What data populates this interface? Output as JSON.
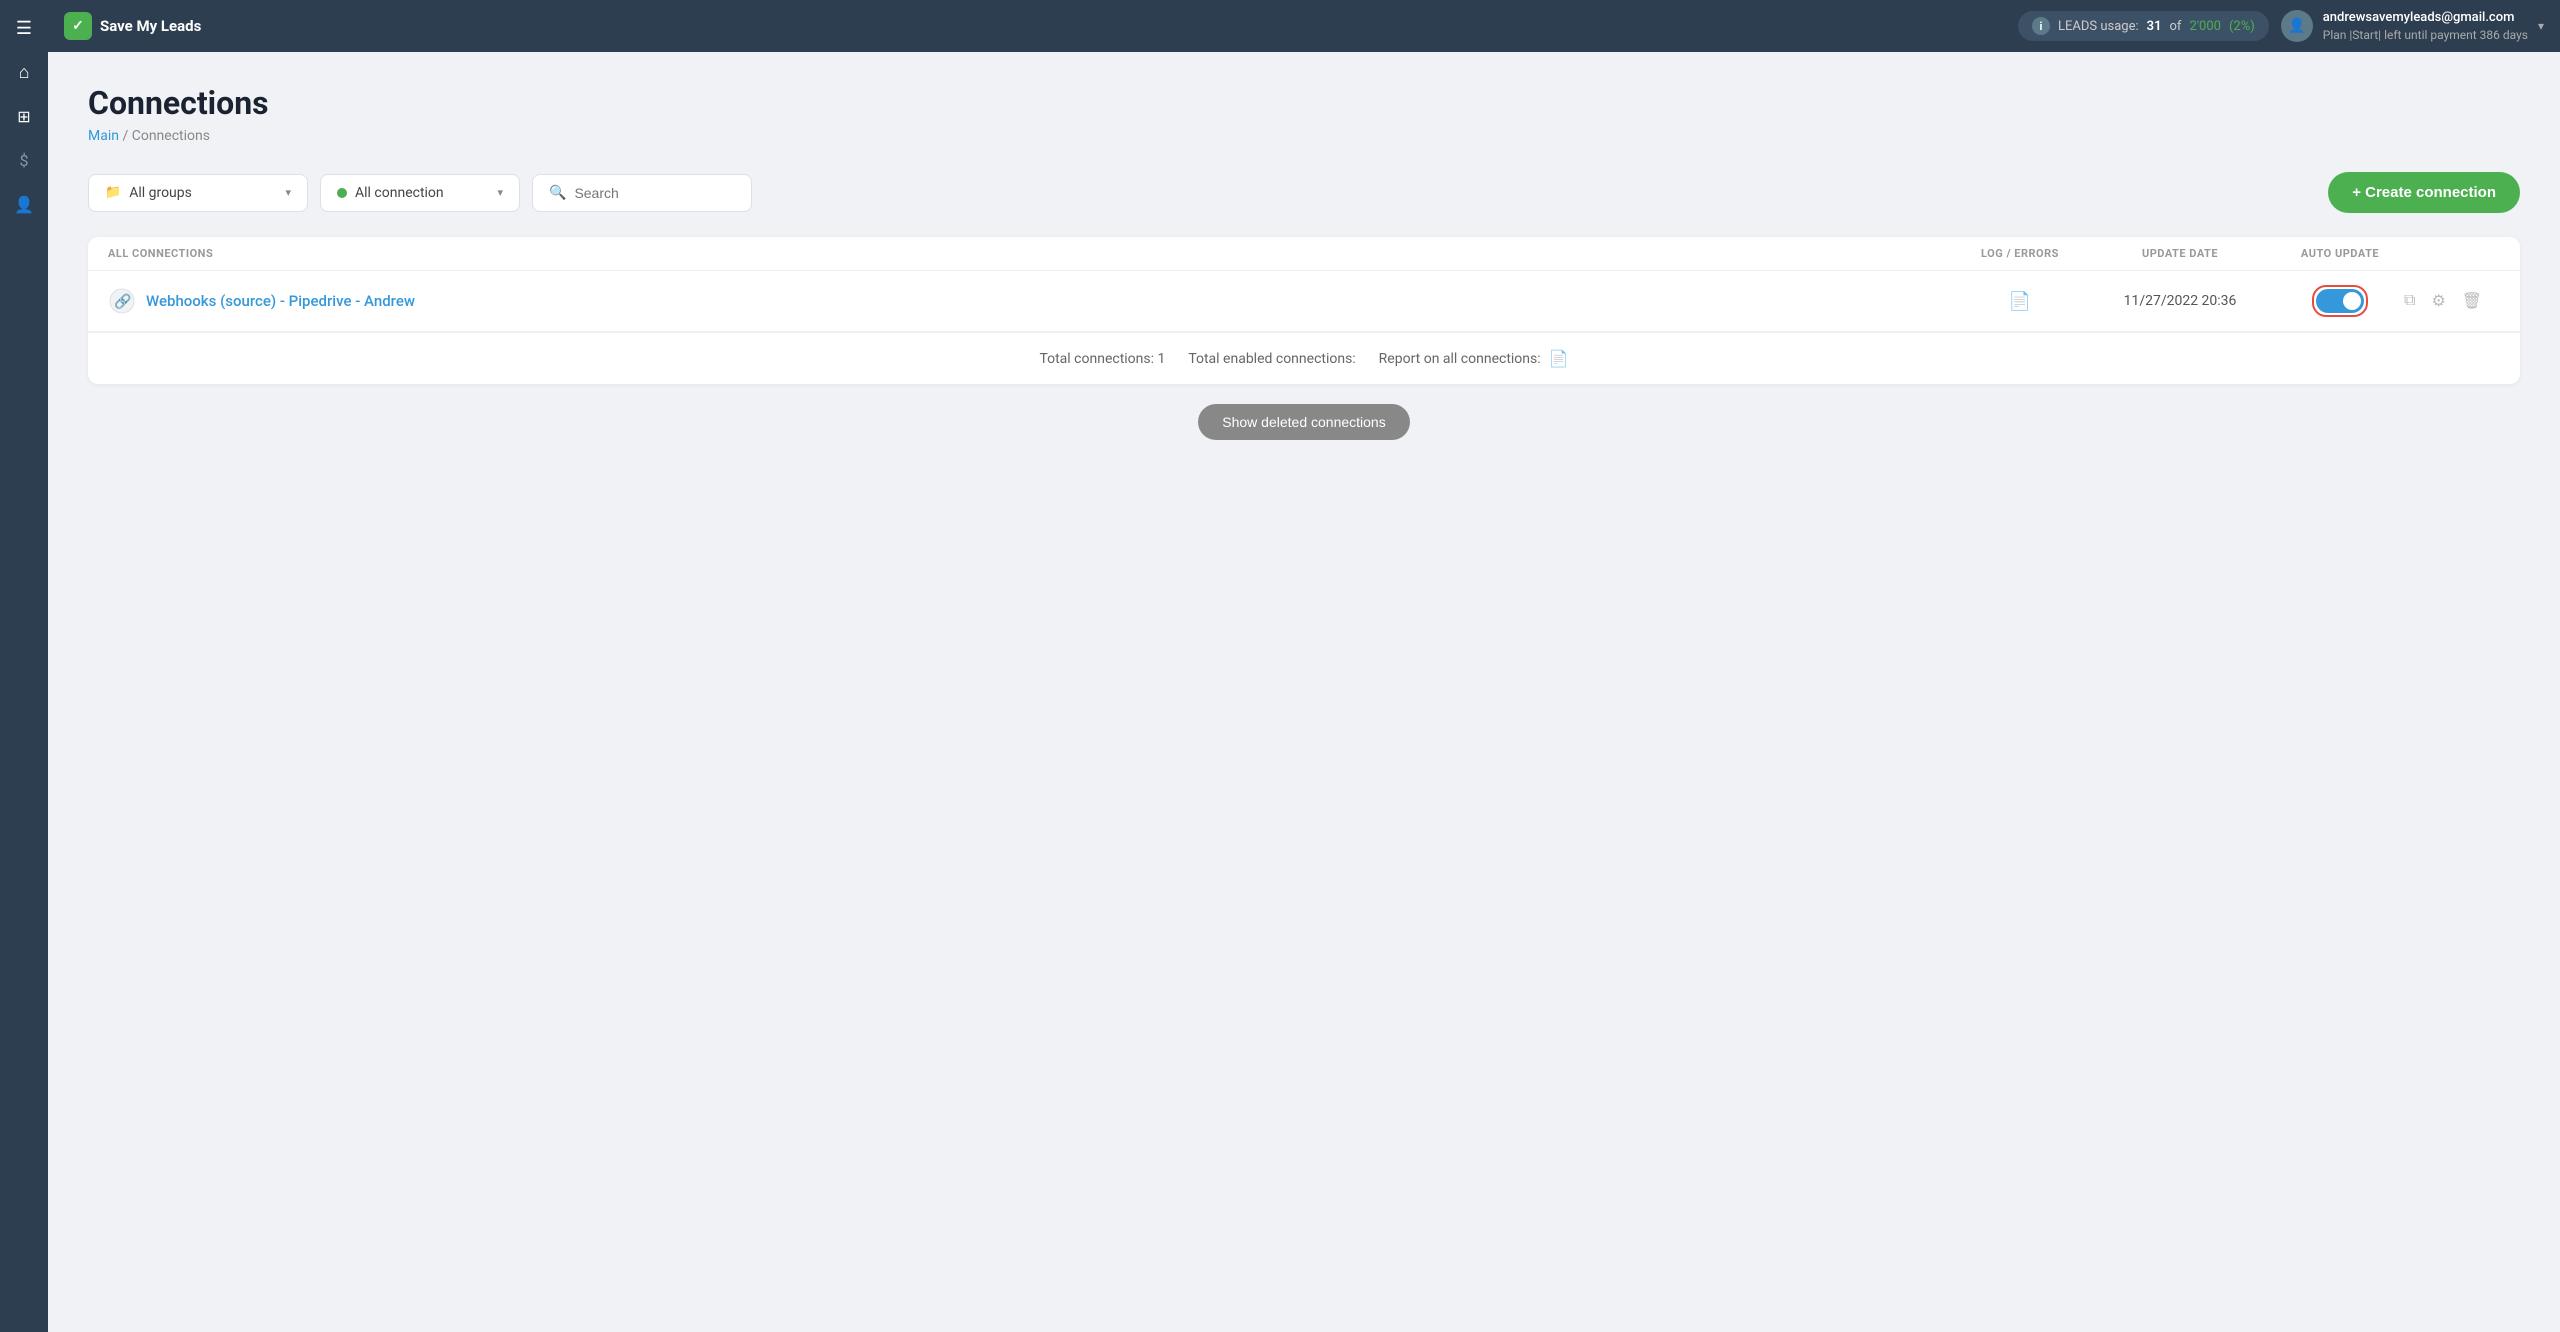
{
  "app": {
    "name": "Save My Leads",
    "logo_text": "✓"
  },
  "topnav": {
    "leads_usage_label": "LEADS usage:",
    "leads_current": "31",
    "leads_total": "2'000",
    "leads_percent": "(2%)",
    "user_email": "andrewsavemyleads@gmail.com",
    "user_plan": "Plan |Start| left until payment 386 days",
    "info_icon": "i"
  },
  "sidebar": {
    "items": [
      {
        "icon": "☰",
        "name": "menu"
      },
      {
        "icon": "⌂",
        "name": "home"
      },
      {
        "icon": "⊞",
        "name": "integrations"
      },
      {
        "icon": "$",
        "name": "billing"
      },
      {
        "icon": "👤",
        "name": "profile"
      }
    ]
  },
  "page": {
    "title": "Connections",
    "breadcrumb_main": "Main",
    "breadcrumb_separator": " / ",
    "breadcrumb_current": "Connections"
  },
  "filters": {
    "groups_label": "All groups",
    "connection_label": "All connection",
    "search_placeholder": "Search",
    "create_button": "+ Create connection"
  },
  "table": {
    "columns": {
      "all_connections": "ALL CONNECTIONS",
      "log_errors": "LOG / ERRORS",
      "update_date": "UPDATE DATE",
      "auto_update": "AUTO UPDATE"
    },
    "rows": [
      {
        "name": "Webhooks (source) - Pipedrive - Andrew",
        "update_date": "11/27/2022 20:36",
        "auto_update": true
      }
    ]
  },
  "footer": {
    "total_connections": "Total connections: 1",
    "total_enabled": "Total enabled connections:",
    "report_label": "Report on all connections:"
  },
  "show_deleted": {
    "button_label": "Show deleted connections"
  }
}
